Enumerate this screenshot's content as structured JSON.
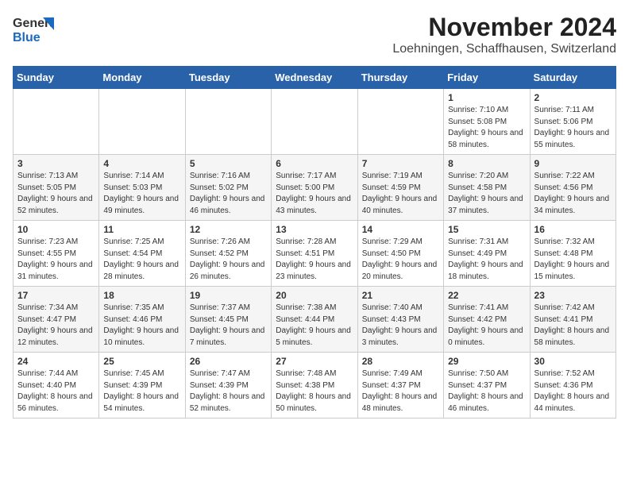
{
  "logo": {
    "line1": "General",
    "line2": "Blue"
  },
  "title": "November 2024",
  "subtitle": "Loehningen, Schaffhausen, Switzerland",
  "days_of_week": [
    "Sunday",
    "Monday",
    "Tuesday",
    "Wednesday",
    "Thursday",
    "Friday",
    "Saturday"
  ],
  "weeks": [
    [
      {
        "day": "",
        "info": ""
      },
      {
        "day": "",
        "info": ""
      },
      {
        "day": "",
        "info": ""
      },
      {
        "day": "",
        "info": ""
      },
      {
        "day": "",
        "info": ""
      },
      {
        "day": "1",
        "info": "Sunrise: 7:10 AM\nSunset: 5:08 PM\nDaylight: 9 hours\nand 58 minutes."
      },
      {
        "day": "2",
        "info": "Sunrise: 7:11 AM\nSunset: 5:06 PM\nDaylight: 9 hours\nand 55 minutes."
      }
    ],
    [
      {
        "day": "3",
        "info": "Sunrise: 7:13 AM\nSunset: 5:05 PM\nDaylight: 9 hours\nand 52 minutes."
      },
      {
        "day": "4",
        "info": "Sunrise: 7:14 AM\nSunset: 5:03 PM\nDaylight: 9 hours\nand 49 minutes."
      },
      {
        "day": "5",
        "info": "Sunrise: 7:16 AM\nSunset: 5:02 PM\nDaylight: 9 hours\nand 46 minutes."
      },
      {
        "day": "6",
        "info": "Sunrise: 7:17 AM\nSunset: 5:00 PM\nDaylight: 9 hours\nand 43 minutes."
      },
      {
        "day": "7",
        "info": "Sunrise: 7:19 AM\nSunset: 4:59 PM\nDaylight: 9 hours\nand 40 minutes."
      },
      {
        "day": "8",
        "info": "Sunrise: 7:20 AM\nSunset: 4:58 PM\nDaylight: 9 hours\nand 37 minutes."
      },
      {
        "day": "9",
        "info": "Sunrise: 7:22 AM\nSunset: 4:56 PM\nDaylight: 9 hours\nand 34 minutes."
      }
    ],
    [
      {
        "day": "10",
        "info": "Sunrise: 7:23 AM\nSunset: 4:55 PM\nDaylight: 9 hours\nand 31 minutes."
      },
      {
        "day": "11",
        "info": "Sunrise: 7:25 AM\nSunset: 4:54 PM\nDaylight: 9 hours\nand 28 minutes."
      },
      {
        "day": "12",
        "info": "Sunrise: 7:26 AM\nSunset: 4:52 PM\nDaylight: 9 hours\nand 26 minutes."
      },
      {
        "day": "13",
        "info": "Sunrise: 7:28 AM\nSunset: 4:51 PM\nDaylight: 9 hours\nand 23 minutes."
      },
      {
        "day": "14",
        "info": "Sunrise: 7:29 AM\nSunset: 4:50 PM\nDaylight: 9 hours\nand 20 minutes."
      },
      {
        "day": "15",
        "info": "Sunrise: 7:31 AM\nSunset: 4:49 PM\nDaylight: 9 hours\nand 18 minutes."
      },
      {
        "day": "16",
        "info": "Sunrise: 7:32 AM\nSunset: 4:48 PM\nDaylight: 9 hours\nand 15 minutes."
      }
    ],
    [
      {
        "day": "17",
        "info": "Sunrise: 7:34 AM\nSunset: 4:47 PM\nDaylight: 9 hours\nand 12 minutes."
      },
      {
        "day": "18",
        "info": "Sunrise: 7:35 AM\nSunset: 4:46 PM\nDaylight: 9 hours\nand 10 minutes."
      },
      {
        "day": "19",
        "info": "Sunrise: 7:37 AM\nSunset: 4:45 PM\nDaylight: 9 hours\nand 7 minutes."
      },
      {
        "day": "20",
        "info": "Sunrise: 7:38 AM\nSunset: 4:44 PM\nDaylight: 9 hours\nand 5 minutes."
      },
      {
        "day": "21",
        "info": "Sunrise: 7:40 AM\nSunset: 4:43 PM\nDaylight: 9 hours\nand 3 minutes."
      },
      {
        "day": "22",
        "info": "Sunrise: 7:41 AM\nSunset: 4:42 PM\nDaylight: 9 hours\nand 0 minutes."
      },
      {
        "day": "23",
        "info": "Sunrise: 7:42 AM\nSunset: 4:41 PM\nDaylight: 8 hours\nand 58 minutes."
      }
    ],
    [
      {
        "day": "24",
        "info": "Sunrise: 7:44 AM\nSunset: 4:40 PM\nDaylight: 8 hours\nand 56 minutes."
      },
      {
        "day": "25",
        "info": "Sunrise: 7:45 AM\nSunset: 4:39 PM\nDaylight: 8 hours\nand 54 minutes."
      },
      {
        "day": "26",
        "info": "Sunrise: 7:47 AM\nSunset: 4:39 PM\nDaylight: 8 hours\nand 52 minutes."
      },
      {
        "day": "27",
        "info": "Sunrise: 7:48 AM\nSunset: 4:38 PM\nDaylight: 8 hours\nand 50 minutes."
      },
      {
        "day": "28",
        "info": "Sunrise: 7:49 AM\nSunset: 4:37 PM\nDaylight: 8 hours\nand 48 minutes."
      },
      {
        "day": "29",
        "info": "Sunrise: 7:50 AM\nSunset: 4:37 PM\nDaylight: 8 hours\nand 46 minutes."
      },
      {
        "day": "30",
        "info": "Sunrise: 7:52 AM\nSunset: 4:36 PM\nDaylight: 8 hours\nand 44 minutes."
      }
    ]
  ]
}
